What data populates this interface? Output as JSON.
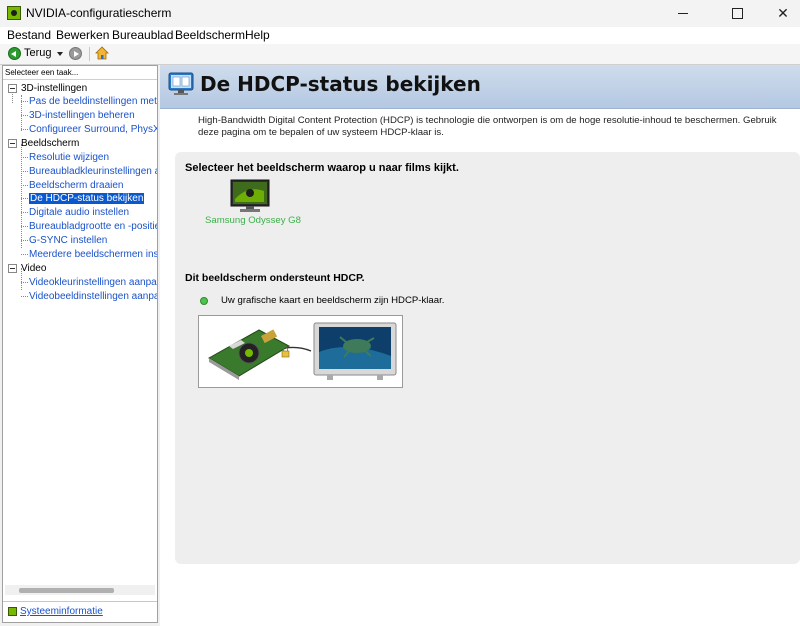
{
  "window": {
    "title": "NVIDIA-configuratiescherm",
    "minimize": "",
    "maximize": "",
    "close": "✕"
  },
  "menu": [
    "Bestand",
    "Bewerken",
    "Bureaublad",
    "Beeldscherm",
    "Help"
  ],
  "toolbar": {
    "back_label": "Terug"
  },
  "sidebar": {
    "header": "Selecteer een taak...",
    "categories": [
      {
        "label": "3D-instellingen",
        "items": [
          "Pas de beeldinstellingen met vo",
          "3D-instellingen beheren",
          "Configureer Surround, PhysX"
        ]
      },
      {
        "label": "Beeldscherm",
        "items": [
          "Resolutie wijzigen",
          "Bureaubladkleurinstellingen aan",
          "Beeldscherm draaien",
          "De HDCP-status bekijken",
          "Digitale audio instellen",
          "Bureaubladgrootte en -positie a",
          "G-SYNC instellen",
          "Meerdere beeldschermen instell"
        ]
      },
      {
        "label": "Video",
        "items": [
          "Videokleurinstellingen aanpasse",
          "Videobeeldinstellingen aanpasse"
        ]
      }
    ],
    "selected": "De HDCP-status bekijken",
    "system_info": "Systeeminformatie"
  },
  "page": {
    "title": "De HDCP-status bekijken",
    "description": "High-Bandwidth Digital Content Protection (HDCP) is technologie die ontworpen is om de hoge resolutie-inhoud te beschermen. Gebruik deze pagina om te bepalen of uw systeem HDCP-klaar is.",
    "select_label": "Selecteer het beeldscherm waarop u naar films kijkt.",
    "monitor_name": "Samsung Odyssey G8",
    "hdcp_title": "Dit beeldscherm ondersteunt HDCP.",
    "status_text": "Uw grafische kaart en beeldscherm zijn HDCP-klaar."
  },
  "colors": {
    "accent": "#76b900",
    "selection": "#0a58d0",
    "link": "#1a52c9",
    "ok": "#4cc44c"
  }
}
